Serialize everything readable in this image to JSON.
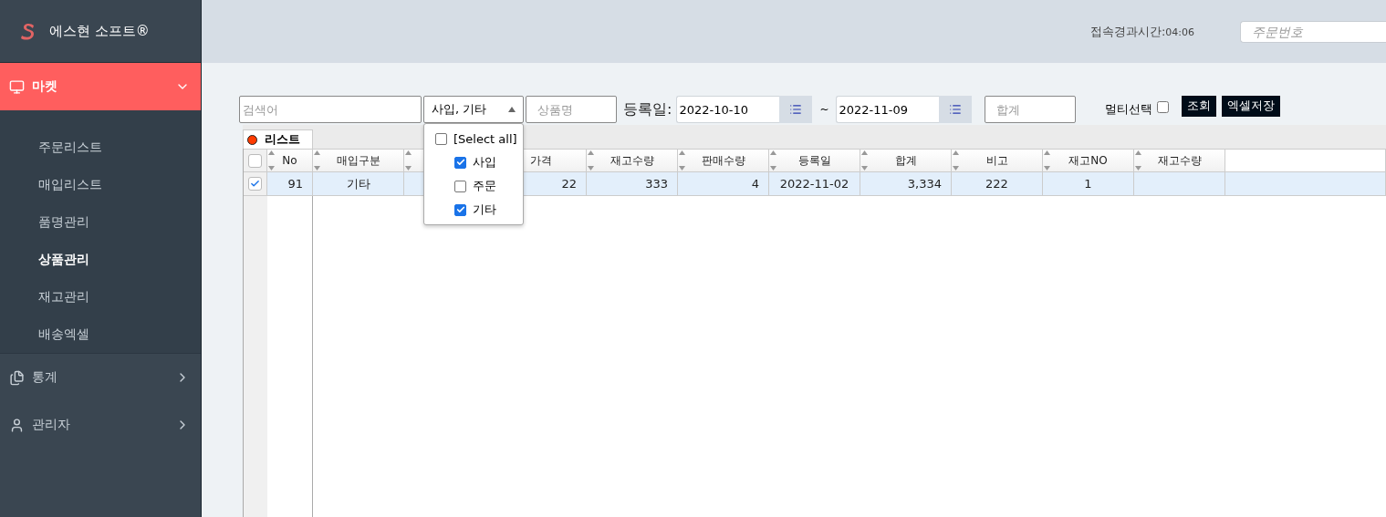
{
  "brand": {
    "name": "에스현 소프트®"
  },
  "header": {
    "elapsed_label": "접속경과시간:",
    "elapsed_time": "04:06",
    "order_search": {
      "placeholder": "주문번호"
    }
  },
  "sidebar": {
    "items": [
      {
        "label": "마켓",
        "kind": "monitor",
        "expanded": true,
        "children": [
          {
            "label": "주문리스트",
            "selected": false
          },
          {
            "label": "매입리스트",
            "selected": false
          },
          {
            "label": "품명관리",
            "selected": false
          },
          {
            "label": "상품관리",
            "selected": true
          },
          {
            "label": "재고관리",
            "selected": false
          },
          {
            "label": "배송엑셀",
            "selected": false
          }
        ]
      },
      {
        "label": "통계",
        "kind": "document",
        "expanded": false
      },
      {
        "label": "관리자",
        "kind": "user",
        "expanded": false
      }
    ]
  },
  "filters": {
    "keyword": {
      "placeholder": "검색어"
    },
    "type_select": {
      "value": "사입, 기타",
      "expanded": true,
      "options": [
        {
          "label": "[Select all]",
          "checked": false,
          "kind": "all"
        },
        {
          "label": "사입",
          "checked": true,
          "kind": "option"
        },
        {
          "label": "주문",
          "checked": false,
          "kind": "option"
        },
        {
          "label": "기타",
          "checked": true,
          "kind": "option"
        }
      ]
    },
    "product": {
      "placeholder": "상품명"
    },
    "date_label": "등록일:",
    "date_from": "2022-10-10",
    "date_sep": "~",
    "date_to": "2022-11-09",
    "total": {
      "placeholder": "합계"
    },
    "multi_select": {
      "label": "멀티선택",
      "checked": false
    },
    "buttons": [
      "조회",
      "엑셀저장"
    ]
  },
  "grid": {
    "tab": {
      "label": "리스트",
      "color": "#ff3b00"
    },
    "header_checked": false,
    "columns": [
      {
        "label": "No",
        "sort_marks": true
      },
      {
        "label": "매입구분",
        "sort_marks": true
      },
      {
        "sort_marks": true
      },
      {
        "label": "가격",
        "sort_marks": false
      },
      {
        "label": "재고수량",
        "sort_marks": true
      },
      {
        "label": "판매수량",
        "sort_marks": true
      },
      {
        "label": "등록일",
        "sort_marks": true
      },
      {
        "label": "합계",
        "sort_marks": true
      },
      {
        "label": "비고",
        "sort_marks": true
      },
      {
        "label": "재고NO",
        "sort_marks": true
      },
      {
        "label": "재고수량",
        "sort_marks": true
      }
    ],
    "rows": [
      {
        "selected": true,
        "cells": [
          "91",
          "기타",
          null,
          "22",
          "333",
          "4",
          "2022-11-02",
          "3,334",
          "222",
          "1",
          null
        ]
      }
    ]
  }
}
